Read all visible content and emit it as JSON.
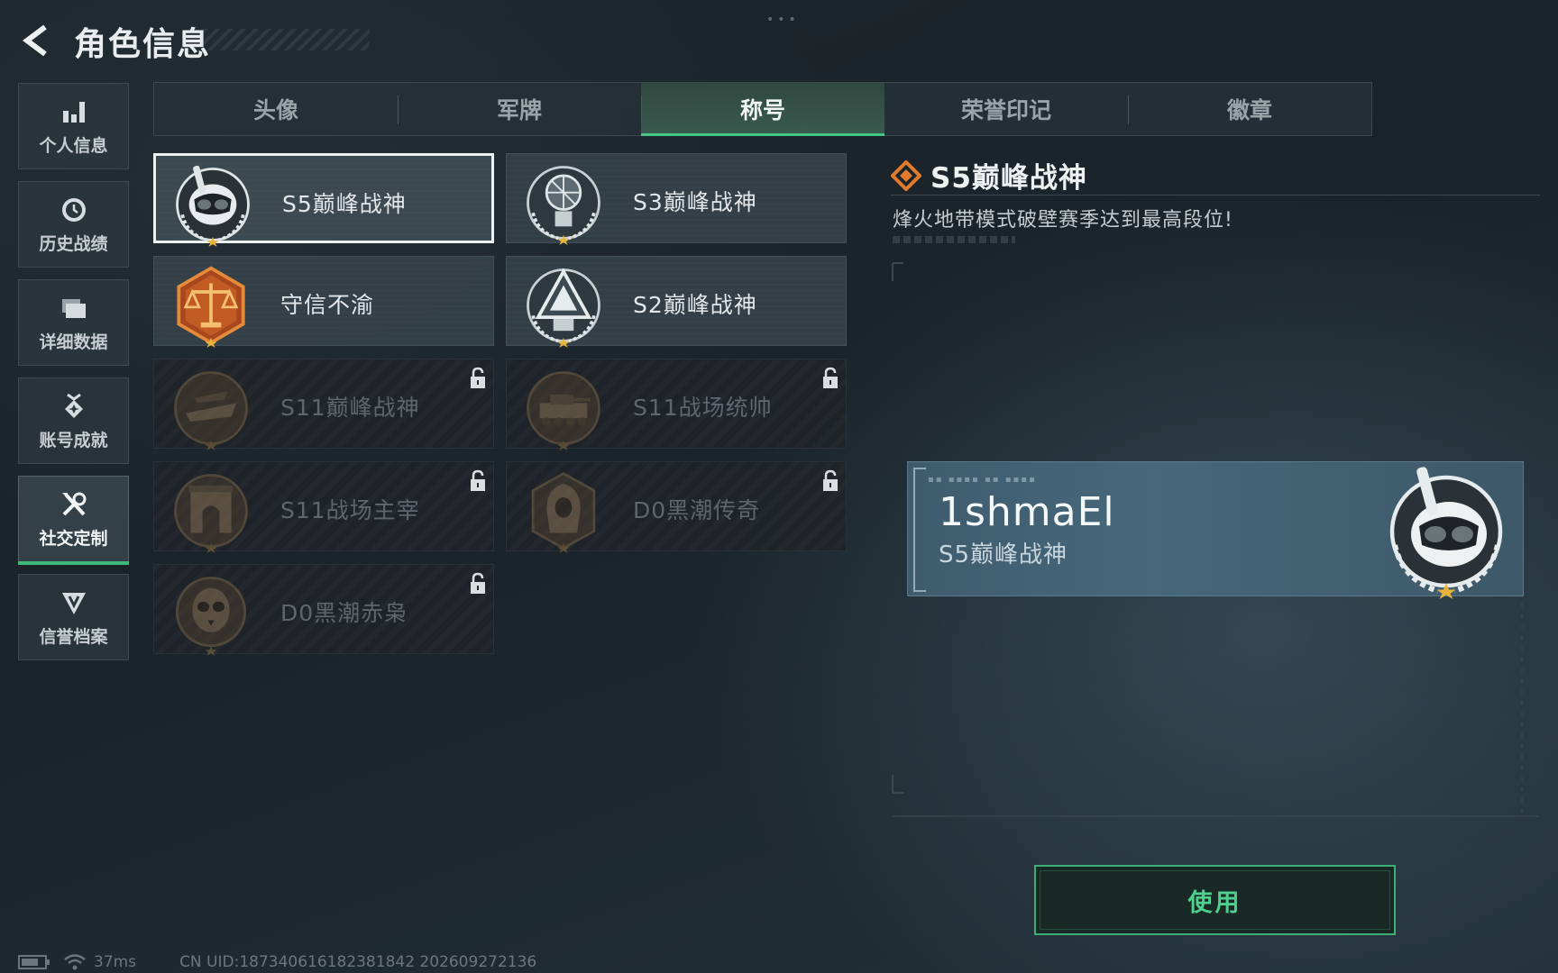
{
  "header": {
    "title": "角色信息"
  },
  "sidebar": {
    "items": [
      {
        "label": "个人信息",
        "icon": "bar-chart-icon",
        "active": false
      },
      {
        "label": "历史战绩",
        "icon": "clock-icon",
        "active": false
      },
      {
        "label": "详细数据",
        "icon": "folder-icon",
        "active": false
      },
      {
        "label": "账号成就",
        "icon": "achievement-icon",
        "active": false
      },
      {
        "label": "社交定制",
        "icon": "tools-icon",
        "active": true
      },
      {
        "label": "信誉档案",
        "icon": "reputation-icon",
        "active": false
      }
    ]
  },
  "tabs": [
    {
      "label": "头像",
      "active": false
    },
    {
      "label": "军牌",
      "active": false
    },
    {
      "label": "称号",
      "active": true
    },
    {
      "label": "荣誉印记",
      "active": false
    },
    {
      "label": "徽章",
      "active": false
    }
  ],
  "titles": [
    {
      "name": "S5巅峰战神",
      "badge": "diver-skull-badge-icon",
      "locked": false,
      "selected": true
    },
    {
      "name": "S3巅峰战神",
      "badge": "globe-badge-icon",
      "locked": false,
      "selected": false
    },
    {
      "name": "守信不渝",
      "badge": "scales-badge-icon",
      "locked": false,
      "selected": false
    },
    {
      "name": "S2巅峰战神",
      "badge": "triangle-badge-icon",
      "locked": false,
      "selected": false
    },
    {
      "name": "S11巅峰战神",
      "badge": "aircraft-badge-icon",
      "locked": true,
      "selected": false
    },
    {
      "name": "S11战场统帅",
      "badge": "tank-badge-icon",
      "locked": true,
      "selected": false
    },
    {
      "name": "S11战场主宰",
      "badge": "arch-badge-icon",
      "locked": true,
      "selected": false
    },
    {
      "name": "D0黑潮传奇",
      "badge": "hooded-figure-badge-icon",
      "locked": true,
      "selected": false
    },
    {
      "name": "D0黑潮赤枭",
      "badge": "owl-skull-badge-icon",
      "locked": true,
      "selected": false
    }
  ],
  "detail": {
    "name": "S5巅峰战神",
    "description": "烽火地带模式破壁赛季达到最高段位!"
  },
  "preview": {
    "player_name": "1shmaEl",
    "title": "S5巅峰战神"
  },
  "use_button": {
    "label": "使用"
  },
  "footer": {
    "ping": "37ms",
    "uid": "CN UID:187340616182381842 202609272136"
  },
  "colors": {
    "accent_green": "#43c583",
    "badge_orange": "#e07a2e",
    "badge_gold": "#e7b33a"
  }
}
